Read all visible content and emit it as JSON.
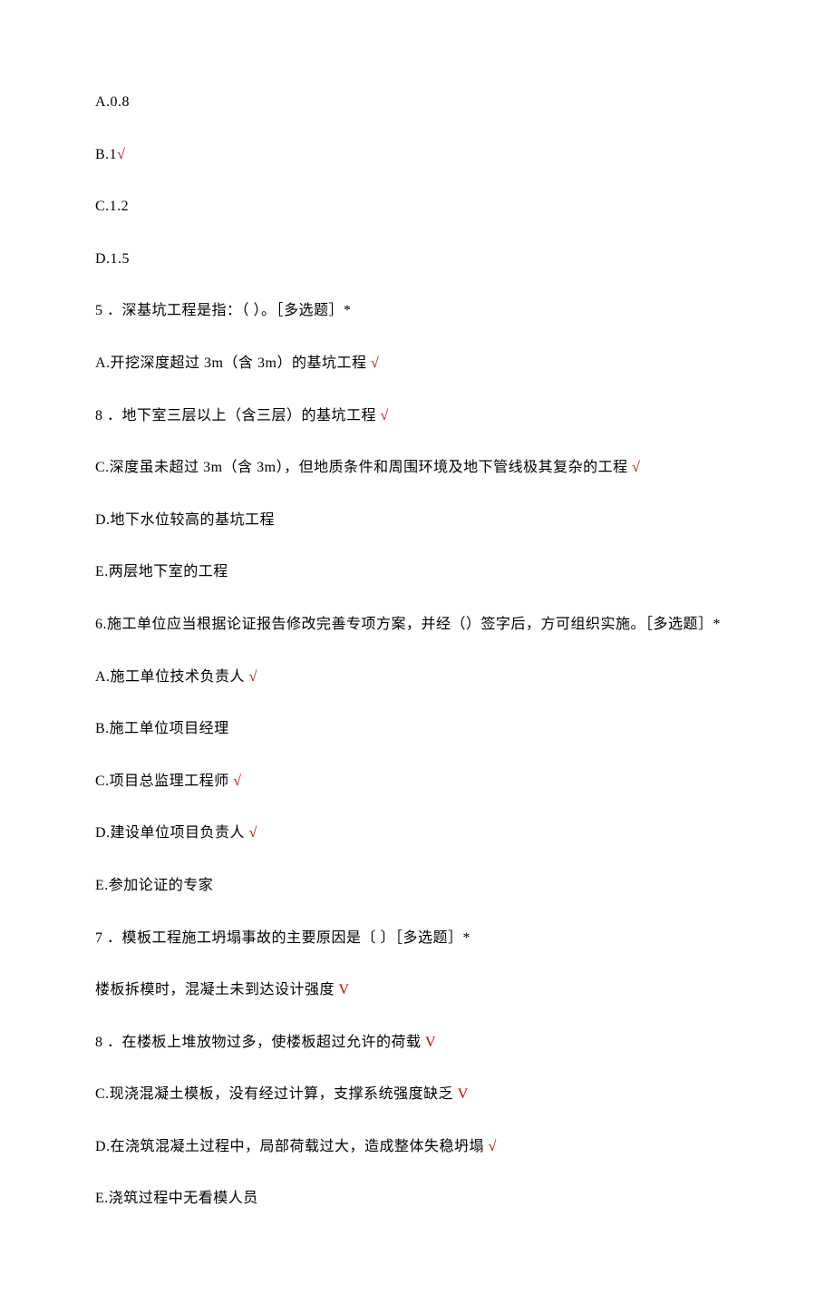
{
  "q4": {
    "optionA": "A.0.8",
    "optionB_prefix": "B.1",
    "optionB_mark": "√",
    "optionC": "C.1.2",
    "optionD": "D.1.5"
  },
  "q5": {
    "stem": "5 ．深基坑工程是指：（ ）。［多选题］*",
    "optionA_text": "A.开挖深度超过 3m（含 3m）的基坑工程 ",
    "optionA_mark": "√",
    "optionB_text": "8 ．地下室三层以上（含三层）的基坑工程 ",
    "optionB_mark": "√",
    "optionC_text": "C.深度虽未超过 3m（含 3m），但地质条件和周围环境及地下管线极其复杂的工程 ",
    "optionC_mark": "√",
    "optionD": "D.地下水位较高的基坑工程",
    "optionE": "E.两层地下室的工程"
  },
  "q6": {
    "stem": "6.施工单位应当根据论证报告修改完善专项方案，并经（）签字后，方可组织实施。［多选题］*",
    "optionA_text": "A.施工单位技术负责人 ",
    "optionA_mark": "√",
    "optionB": "B.施工单位项目经理",
    "optionC_text": "C.项目总监理工程师 ",
    "optionC_mark": "√",
    "optionD_text": "D.建设单位项目负责人 ",
    "optionD_mark": "√",
    "optionE": "E.参加论证的专家"
  },
  "q7": {
    "stem": "7 ．模板工程施工坍塌事故的主要原因是〔 〕［多选题］*",
    "optionA_text": "楼板拆模时，混凝土未到达设计强度 ",
    "optionA_mark": "V",
    "optionB_text": "8 ．在楼板上堆放物过多，使楼板超过允许的荷载 ",
    "optionB_mark": "V",
    "optionC_text": "C.现浇混凝土模板，没有经过计算，支撑系统强度缺乏 ",
    "optionC_mark": "V",
    "optionD_text": "D.在浇筑混凝土过程中，局部荷载过大，造成整体失稳坍塌 ",
    "optionD_mark": "√",
    "optionE": "E.浇筑过程中无看模人员"
  }
}
